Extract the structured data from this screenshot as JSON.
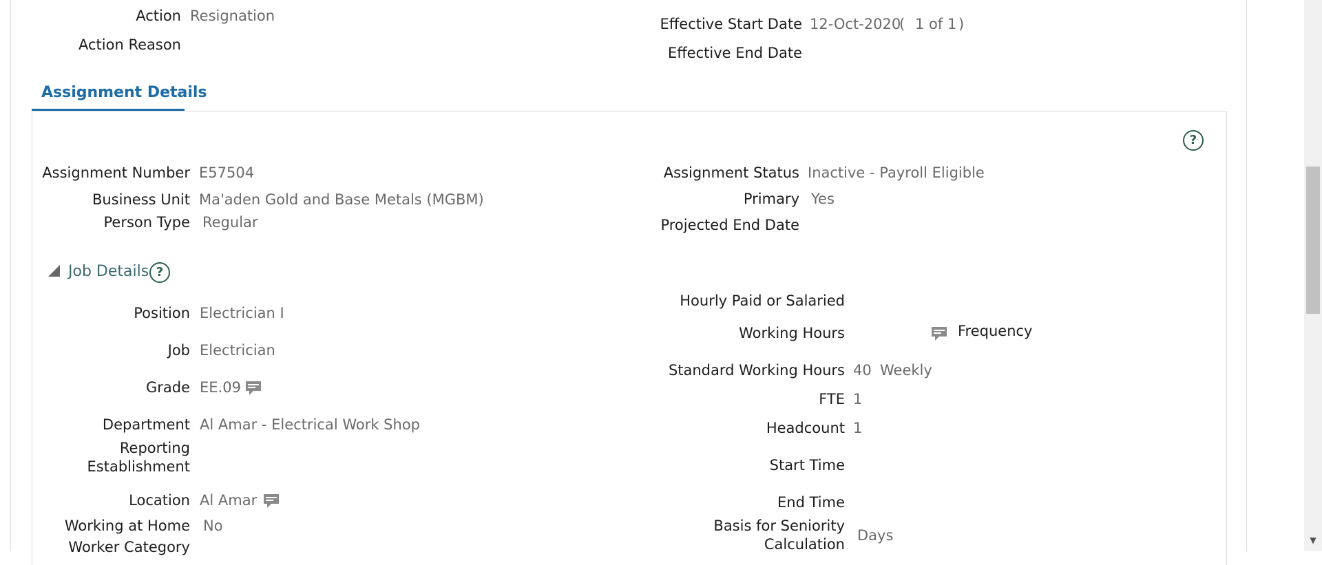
{
  "header": {
    "action_label": "Action",
    "action_value": "Resignation",
    "action_reason_label": "Action Reason",
    "effective_start_label": "Effective Start Date",
    "effective_start_value": "12-Oct-2020",
    "effective_record_open": "(",
    "effective_record_count": "1 of 1",
    "effective_record_close": ")",
    "effective_end_label": "Effective End Date"
  },
  "tab": {
    "label": "Assignment Details"
  },
  "assignment": {
    "number_label": "Assignment Number",
    "number_value": "E57504",
    "business_unit_label": "Business Unit",
    "business_unit_value": "Ma'aden Gold and Base Metals (MGBM)",
    "person_type_label": "Person Type",
    "person_type_value": "Regular",
    "status_label": "Assignment Status",
    "status_value": "Inactive - Payroll Eligible",
    "primary_label": "Primary",
    "primary_value": "Yes",
    "projected_end_label": "Projected End Date"
  },
  "job_details": {
    "title": "Job Details",
    "position_label": "Position",
    "position_value": "Electrician I",
    "job_label": "Job",
    "job_value": "Electrician",
    "grade_label": "Grade",
    "grade_value": "EE.09",
    "department_label": "Department",
    "department_value": "Al Amar - Electrical Work Shop",
    "reporting_label_line1": "Reporting",
    "reporting_label_line2": "Establishment",
    "location_label": "Location",
    "location_value": "Al Amar",
    "home_label": "Working at Home",
    "home_value": "No",
    "worker_category_label": "Worker Category",
    "hourly_label": "Hourly Paid or Salaried",
    "working_hours_label": "Working Hours",
    "frequency_label": "Frequency",
    "std_hours_label": "Standard Working Hours",
    "std_hours_value": "40",
    "std_hours_freq": "Weekly",
    "fte_label": "FTE",
    "fte_value": "1",
    "headcount_label": "Headcount",
    "headcount_value": "1",
    "start_time_label": "Start Time",
    "end_time_label": "End Time",
    "seniority_label_line1": "Basis for Seniority",
    "seniority_label_line2": "Calculation",
    "seniority_value": "Days"
  },
  "icons": {
    "help": "help-circle-icon",
    "details": "chat-details-icon",
    "collapse": "collapse-triangle-icon"
  },
  "colors": {
    "accent": "#1d6ca6",
    "section_title": "#3f6a70",
    "value_text": "#6a6a6a"
  }
}
